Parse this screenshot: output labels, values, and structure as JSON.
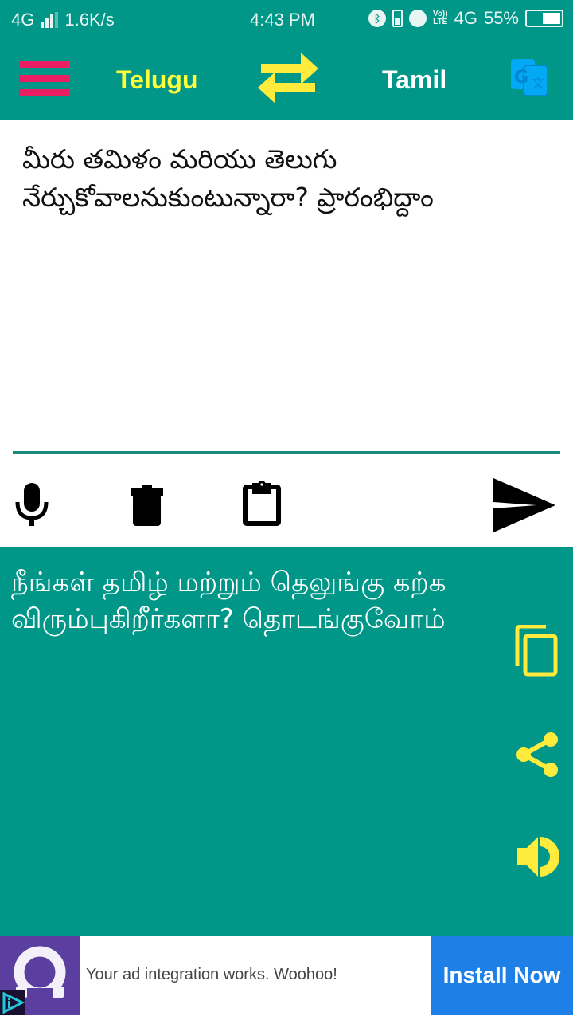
{
  "status_bar": {
    "network": "4G",
    "speed": "1.6K/s",
    "time": "4:43 PM",
    "volte": [
      "Vo))",
      "LTE"
    ],
    "network_right": "4G",
    "battery": "55%",
    "battery_level": 0.55
  },
  "toolbar": {
    "menu_icon": "hamburger-menu-icon",
    "source_language": "Telugu",
    "swap_icon": "swap-arrows-icon",
    "target_language": "Tamil",
    "translate_icon": "google-translate-icon"
  },
  "input": {
    "text": "మీరు తమిళం మరియు తెలుగు నేర్చుకోవాలనుకుంటున్నారా? ప్రారంభిద్దాం"
  },
  "input_actions": {
    "mic_icon": "microphone-icon",
    "delete_icon": "trash-icon",
    "paste_icon": "clipboard-icon",
    "send_icon": "send-icon"
  },
  "output": {
    "text": "நீங்கள் தமிழ் மற்றும் தெலுங்கு கற்க விரும்புகிறீர்களா? தொடங்குவோம்",
    "copy_icon": "copy-icon",
    "share_icon": "share-icon",
    "speak_icon": "speaker-icon"
  },
  "ad": {
    "message": "Your ad integration works. Woohoo!",
    "cta": "Install Now"
  },
  "colors": {
    "primary": "#009688",
    "accent_yellow": "#ffeb3b",
    "menu_pink": "#e91e63",
    "translate_blue": "#03a9f4",
    "ad_purple": "#5b3fa0",
    "ad_cta_blue": "#1e7fe6"
  }
}
